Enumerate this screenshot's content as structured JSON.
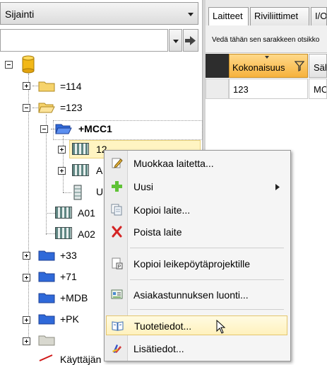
{
  "left_panel": {
    "location_select": "Sijainti",
    "filter_value": "",
    "tree": {
      "root_icon": "database-icon",
      "n114": "=114",
      "n123": "=123",
      "mcc1": "+MCC1",
      "cab12": "12",
      "cabA_partial": "A",
      "cabU_partial": "U",
      "a01": "A01",
      "a02": "A02",
      "n33": "+33",
      "n71": "+71",
      "mdb": "+MDB",
      "pk": "+PK",
      "kayttaja_partial": "Käyttäjän"
    }
  },
  "right_panel": {
    "tabs": [
      "Laitteet",
      "Riviliittimet",
      "I/O"
    ],
    "drag_hint": "Vedä tähän sen sarakkeen otsikko",
    "columns": [
      "Kokonaisuus",
      "Säh"
    ],
    "rows": [
      {
        "kokonaisuus": "123",
        "sah": "MC"
      }
    ]
  },
  "context_menu": {
    "items": [
      {
        "label": "Muokkaa laitetta...",
        "icon": "edit-icon"
      },
      {
        "label": "Uusi",
        "icon": "add-icon"
      },
      {
        "label": "Kopioi laite...",
        "icon": "copy-icon"
      },
      {
        "label": "Poista laite",
        "icon": "delete-icon"
      },
      {
        "label": "Kopioi leikepöytäprojektille",
        "icon": "clipboard-project-icon"
      },
      {
        "label": "Asiakastunnuksen luonti...",
        "icon": "customer-id-icon"
      },
      {
        "label": "Tuotetiedot...",
        "icon": "book-icon"
      },
      {
        "label": "Lisätiedot...",
        "icon": "colors-icon"
      }
    ],
    "highlighted": "Tuotetiedot..."
  }
}
